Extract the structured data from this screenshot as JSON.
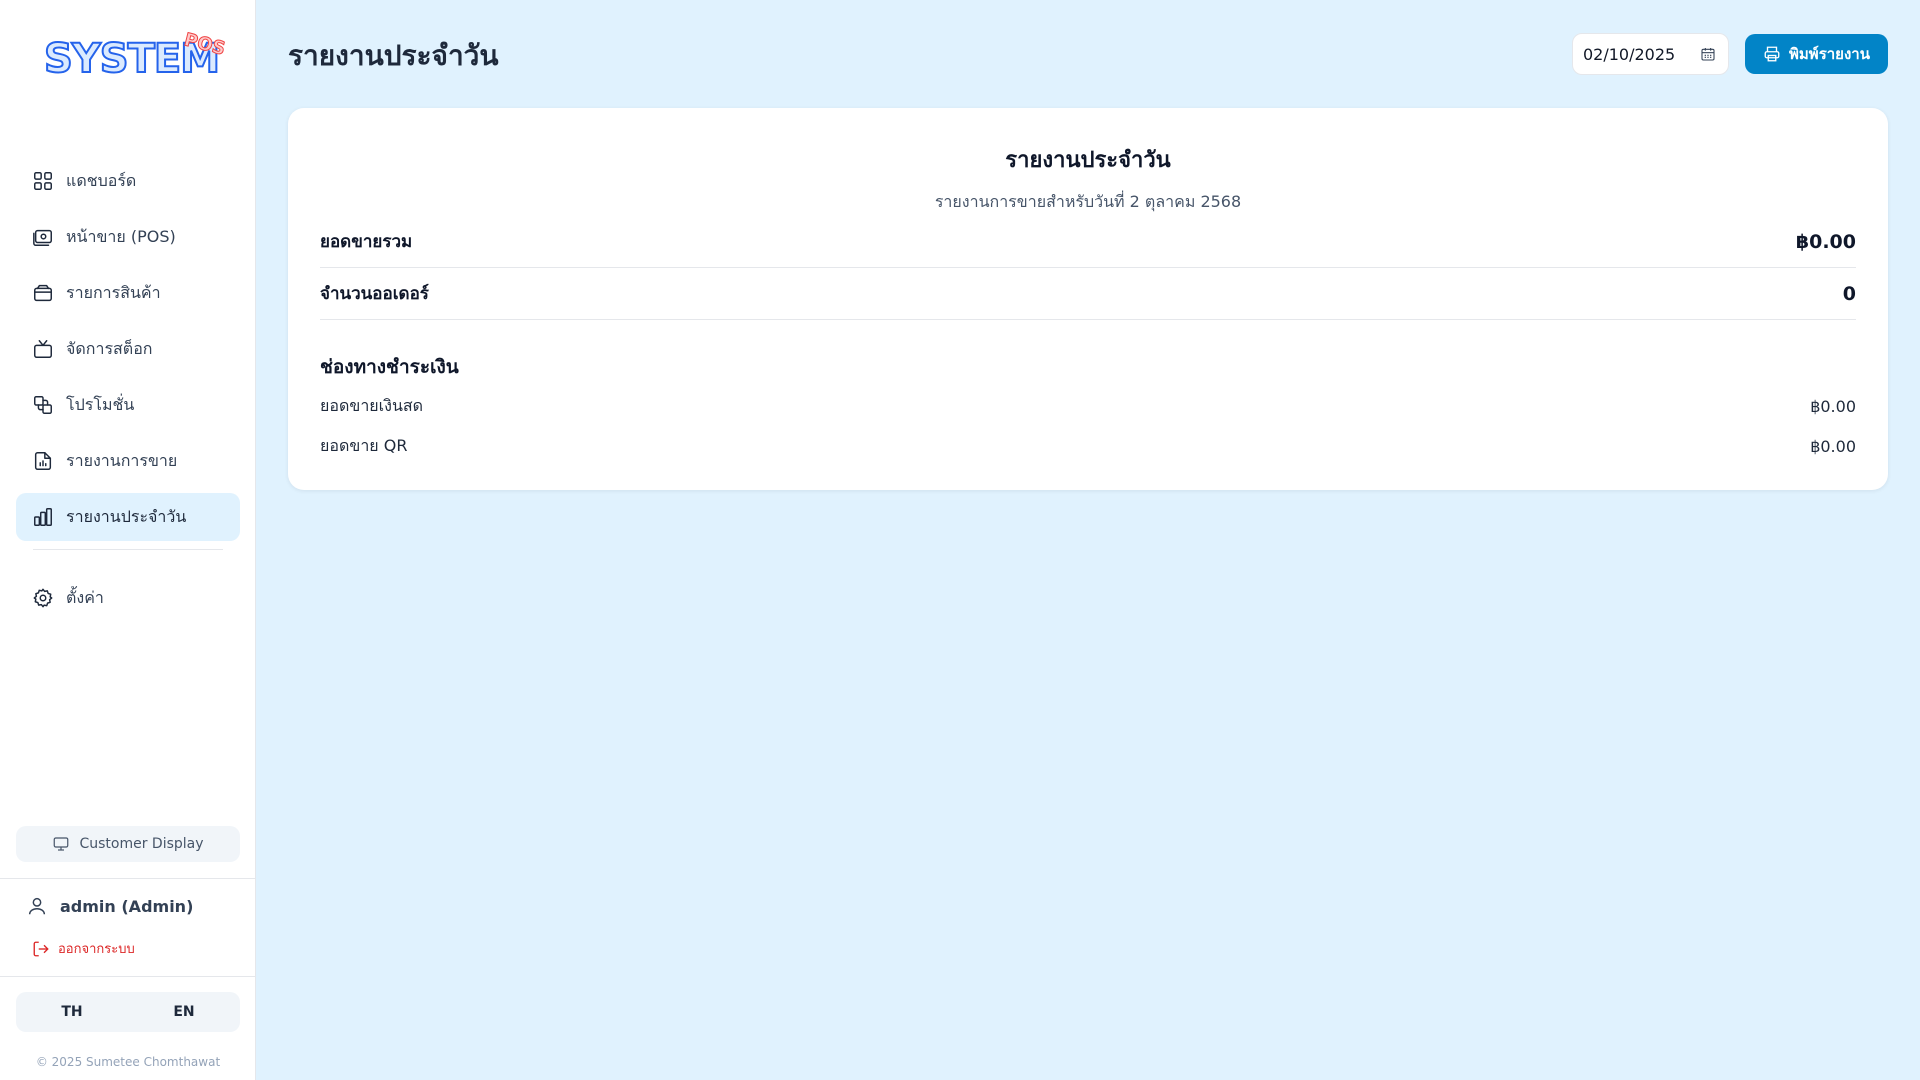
{
  "sidebar": {
    "logo": {
      "main": "SYSTEM",
      "sup": "POS"
    },
    "items": [
      {
        "label": "แดชบอร์ด",
        "icon": "dashboard-grid-icon"
      },
      {
        "label": "หน้าขาย (POS)",
        "icon": "cash-register-icon"
      },
      {
        "label": "รายการสินค้า",
        "icon": "products-box-icon"
      },
      {
        "label": "จัดการสต็อก",
        "icon": "stock-tv-icon"
      },
      {
        "label": "โปรโมชั่น",
        "icon": "promotion-shapes-icon"
      },
      {
        "label": "รายงานการขาย",
        "icon": "report-document-icon"
      },
      {
        "label": "รายงานประจำวัน",
        "icon": "bar-chart-icon",
        "active": true
      }
    ],
    "settings_label": "ตั้งค่า",
    "customer_display_label": "Customer Display",
    "user_label": "admin (Admin)",
    "logout_label": "ออกจากระบบ",
    "lang": {
      "th": "TH",
      "en": "EN"
    },
    "copyright": "© 2025 Sumetee Chomthawat"
  },
  "header": {
    "title": "รายงานประจำวัน",
    "date_value": "02/10/2025",
    "print_label": "พิมพ์รายงาน"
  },
  "report": {
    "title": "รายงานประจำวัน",
    "subtitle": "รายงานการขายสำหรับวันที่ 2 ตุลาคม 2568",
    "total_sales_label": "ยอดขายรวม",
    "total_sales_value": "฿0.00",
    "order_count_label": "จำนวนออเดอร์",
    "order_count_value": "0",
    "payment_section_title": "ช่องทางชำระเงิน",
    "cash_label": "ยอดขายเงินสด",
    "cash_value": "฿0.00",
    "qr_label": "ยอดขาย QR",
    "qr_value": "฿0.00"
  },
  "colors": {
    "accent": "#0284c7",
    "background": "#e0f2fe",
    "active_nav": "#e0f2fe",
    "logout": "#dc2626"
  }
}
